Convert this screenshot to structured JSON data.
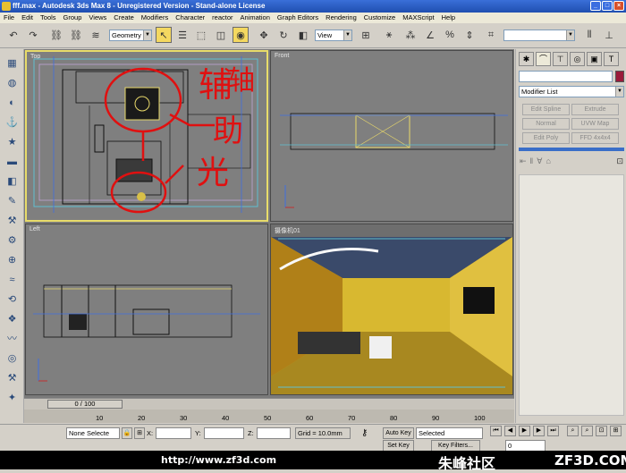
{
  "titlebar": {
    "title": "fff.max - Autodesk 3ds Max 8  - Unregistered Version - Stand-alone License",
    "minimize": "_",
    "restore": "□",
    "close": "×"
  },
  "menu": [
    "File",
    "Edit",
    "Tools",
    "Group",
    "Views",
    "Create",
    "Modifiers",
    "Character",
    "reactor",
    "Animation",
    "Graph Editors",
    "Rendering",
    "Customize",
    "MAXScript",
    "Help"
  ],
  "toolbar": {
    "selection_filter": "Geometry",
    "ref_coord": "View",
    "named_sel": ""
  },
  "viewports": {
    "top": "Top",
    "front": "Front",
    "left": "Left",
    "camera": "摄像机01"
  },
  "annotation": {
    "line1": "轴",
    "line2": "助",
    "line3": "光",
    "extra": "辅"
  },
  "command_panel": {
    "modifier_list": "Modifier List",
    "buttons": [
      "Edit Spline",
      "Extrude",
      "Normal",
      "UVW Map",
      "Edit Poly",
      "FFD 4x4x4"
    ]
  },
  "timeline": {
    "frame": "0 / 100",
    "ticks": [
      "10",
      "20",
      "30",
      "40",
      "50",
      "60",
      "70",
      "80",
      "90",
      "100"
    ]
  },
  "status": {
    "selection": "None Selecte",
    "x_label": "X:",
    "y_label": "Y:",
    "z_label": "Z:",
    "x_value": "",
    "y_value": "",
    "z_value": "",
    "grid": "Grid = 10.0mm",
    "auto_key": "Auto Key",
    "set_key": "Set Key",
    "key_mode": "Selected",
    "key_filters": "Key Filters...",
    "frame_field": "0"
  },
  "footer": {
    "url": "http://www.zf3d.com",
    "brand": "朱峰社区",
    "site": "ZF3D.COM"
  }
}
